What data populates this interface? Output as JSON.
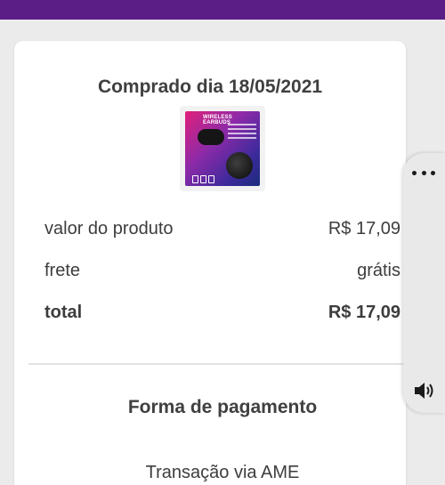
{
  "order": {
    "purchase_date": "Comprado dia 18/05/2021",
    "product_image_text": "WIRELESS EARBUDS"
  },
  "summary": {
    "rows": [
      {
        "label": "valor do produto",
        "value": "R$ 17,09"
      },
      {
        "label": "frete",
        "value": "grátis"
      },
      {
        "label": "total",
        "value": "R$ 17,09"
      }
    ]
  },
  "payment": {
    "title": "Forma de pagamento",
    "method": "Transação via AME"
  },
  "side_panel": {
    "icons": [
      "more-dots-icon",
      "speaker-icon"
    ]
  },
  "colors": {
    "topbar": "#5b1e86",
    "background": "#ebebeb",
    "card": "#ffffff",
    "text": "#3d3d3d"
  }
}
